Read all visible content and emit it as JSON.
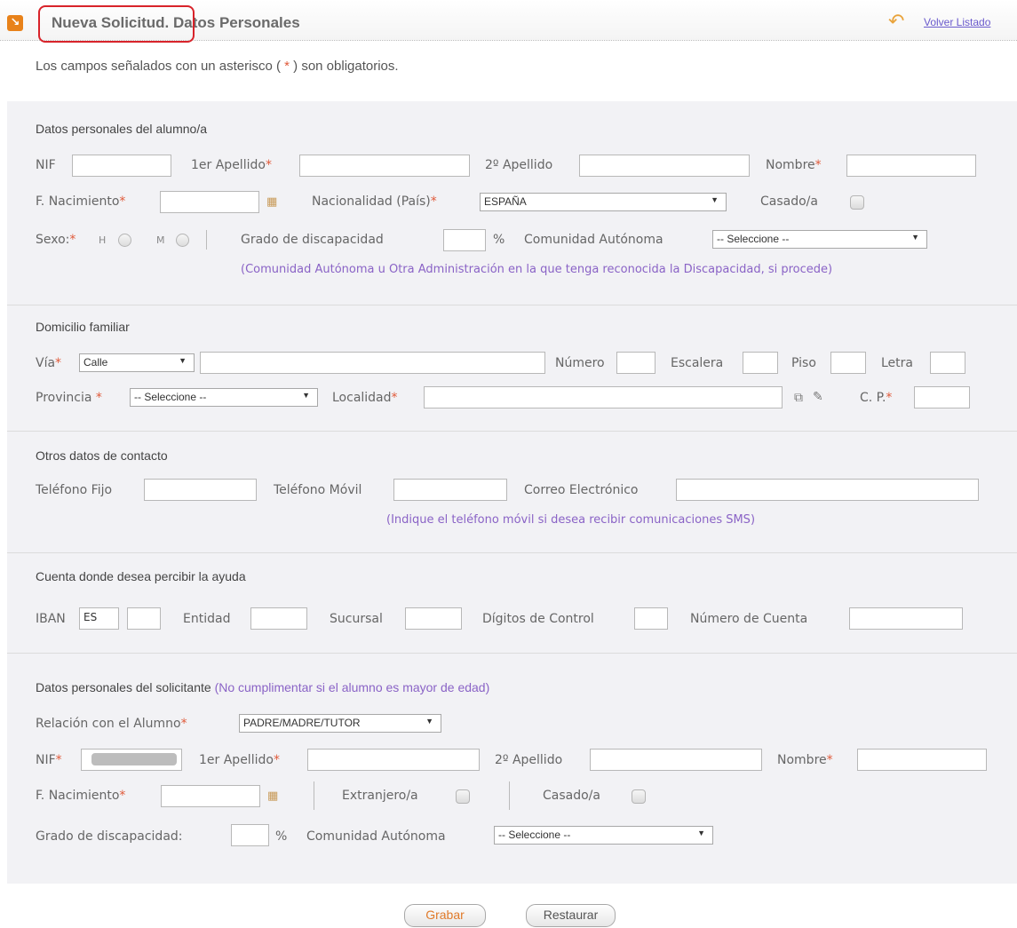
{
  "header": {
    "icon": "arrow-icon",
    "title_main": "Nueva Solicitud.",
    "title_sub": "Datos Personales",
    "back_link": "Volver Listado",
    "back_icon": "return-arrow-icon"
  },
  "note": {
    "prefix": "Los campos señalados con un asterisco (",
    "star": "*",
    "suffix": ") son obligatorios."
  },
  "required_mark": "*",
  "student": {
    "section_title": "Datos personales del alumno/a",
    "nif_label": "NIF",
    "apellido1_label": "1er Apellido",
    "apellido2_label": "2º Apellido",
    "nombre_label": "Nombre",
    "nacimiento_label": "F. Nacimiento",
    "nacionalidad_label": "Nacionalidad (País)",
    "nacionalidad_value": "ESPAÑA",
    "casado_label": "Casado/a",
    "sexo_label": "Sexo:",
    "sexo_h": "H",
    "sexo_m": "M",
    "discapacidad_label": "Grado de discapacidad",
    "percent": "%",
    "comunidad_label": "Comunidad Autónoma",
    "comunidad_value": "-- Seleccione --",
    "hint": "(Comunidad Autónoma u Otra Administración en la que tenga reconocida la Discapacidad, si procede)"
  },
  "address": {
    "section_title": "Domicilio familiar",
    "via_label": "Vía",
    "via_value": "Calle",
    "numero_label": "Número",
    "escalera_label": "Escalera",
    "piso_label": "Piso",
    "letra_label": "Letra",
    "provincia_label": "Provincia",
    "provincia_value": "-- Seleccione --",
    "localidad_label": "Localidad",
    "cp_label": "C. P."
  },
  "contact": {
    "section_title": "Otros datos de contacto",
    "fijo_label": "Teléfono Fijo",
    "movil_label": "Teléfono Móvil",
    "email_label": "Correo Electrónico",
    "hint": "(Indique el teléfono móvil si desea recibir comunicaciones SMS)"
  },
  "account": {
    "section_title": "Cuenta donde desea percibir la ayuda",
    "iban_label": "IBAN",
    "iban_value": "ES",
    "entidad_label": "Entidad",
    "sucursal_label": "Sucursal",
    "control_label": "Dígitos de Control",
    "cuenta_label": "Número de Cuenta"
  },
  "applicant": {
    "section_title": "Datos personales del solicitante",
    "section_hint": "(No cumplimentar si el alumno es mayor de edad)",
    "relacion_label": "Relación con el Alumno",
    "relacion_value": "PADRE/MADRE/TUTOR",
    "nif_label": "NIF",
    "apellido1_label": "1er Apellido",
    "apellido2_label": "2º Apellido",
    "nombre_label": "Nombre",
    "nacimiento_label": "F. Nacimiento",
    "extranjero_label": "Extranjero/a",
    "casado_label": "Casado/a",
    "discapacidad_label": "Grado de discapacidad:",
    "percent": "%",
    "comunidad_label": "Comunidad Autónoma",
    "comunidad_value": "-- Seleccione --"
  },
  "buttons": {
    "grabar": "Grabar",
    "restaurar": "Restaurar"
  },
  "colors": {
    "required": "#e05a3a",
    "hint": "#8a63c6",
    "highlight_circle": "#d8232a",
    "panel_bg": "#f2f2f5"
  }
}
